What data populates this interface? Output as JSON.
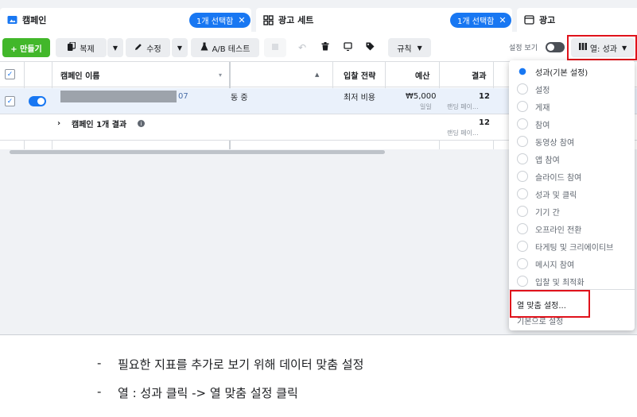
{
  "tabs": {
    "campaign": {
      "label": "캠페인",
      "selected": "1개 선택함"
    },
    "adset": {
      "label": "광고 세트",
      "selected": "1개 선택함"
    },
    "ad": {
      "label": "광고"
    }
  },
  "toolbar": {
    "create": "+ 만들기",
    "duplicate": "복제",
    "edit": "수정",
    "ab_test": "A/B 테스트",
    "rules": "규칙",
    "view_settings": "설정 보기",
    "columns": "열: 성과"
  },
  "table": {
    "headers": {
      "name": "캠페인 이름",
      "bid": "입찰 전략",
      "budget": "예산",
      "result": "결과"
    },
    "row": {
      "name_suffix": "07",
      "delivery": "동 중",
      "bid": "최저 비용",
      "budget": "₩5,000",
      "budget_sub": "일일",
      "result": "12",
      "result_sub": "랜딩 페이..."
    },
    "summary": {
      "label": "캠페인 1개 결과",
      "result": "12",
      "result_sub": "랜딩 페이..."
    }
  },
  "menu": {
    "items": [
      "성과(기본 설정)",
      "설정",
      "게재",
      "참여",
      "동영상 참여",
      "앱 참여",
      "슬라이드 참여",
      "성과 및 클릭",
      "기기 간",
      "오프라인 전환",
      "타게팅 및 크리에이티브",
      "메시지 참여",
      "입찰 및 최적화"
    ],
    "customize": "열 맞춤 설정...",
    "reset": "기본으로 설정"
  },
  "notes": [
    "필요한 지표를 추가로 보기 위해 데이터 맞춤 설정",
    "열 : 성과 클릭 -> 열 맞춤 설정 클릭"
  ],
  "colors": {
    "accent": "#1877f2",
    "create": "#42b72a",
    "highlight": "#e0121b"
  }
}
